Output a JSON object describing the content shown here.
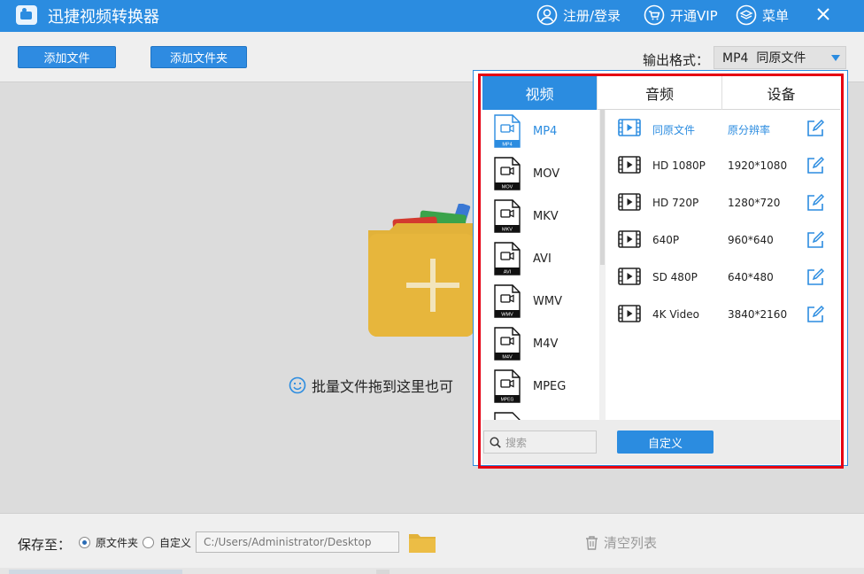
{
  "app": {
    "title": "迅捷视频转换器",
    "register_login": "注册/登录",
    "open_vip": "开通VIP",
    "menu": "菜单"
  },
  "toolbar": {
    "add_file": "添加文件",
    "add_folder": "添加文件夹",
    "output_format_label": "输出格式：",
    "output_format_value": "MP4  同原文件"
  },
  "drop_area": {
    "hint": "批量文件拖到这里也可"
  },
  "bottom": {
    "save_to_label": "保存至：",
    "option_original": "原文件夹",
    "option_custom": "自定义",
    "path": "C:/Users/Administrator/Desktop",
    "clear_list": "清空列表"
  },
  "popup": {
    "tabs": [
      {
        "label": "视频",
        "active": true
      },
      {
        "label": "音频",
        "active": false
      },
      {
        "label": "设备",
        "active": false
      }
    ],
    "formats": [
      {
        "label": "MP4",
        "tag": "MP4",
        "selected": true
      },
      {
        "label": "MOV",
        "tag": "MOV",
        "selected": false
      },
      {
        "label": "MKV",
        "tag": "MKV",
        "selected": false
      },
      {
        "label": "AVI",
        "tag": "AVI",
        "selected": false
      },
      {
        "label": "WMV",
        "tag": "WMV",
        "selected": false
      },
      {
        "label": "M4V",
        "tag": "M4V",
        "selected": false
      },
      {
        "label": "MPEG",
        "tag": "MPEG",
        "selected": false
      }
    ],
    "presets": [
      {
        "name": "同原文件",
        "resolution": "原分辨率",
        "highlight": true
      },
      {
        "name": "HD 1080P",
        "resolution": "1920*1080",
        "highlight": false
      },
      {
        "name": "HD 720P",
        "resolution": "1280*720",
        "highlight": false
      },
      {
        "name": "640P",
        "resolution": "960*640",
        "highlight": false
      },
      {
        "name": "SD 480P",
        "resolution": "640*480",
        "highlight": false
      },
      {
        "name": "4K Video",
        "resolution": "3840*2160",
        "highlight": false
      }
    ],
    "search_placeholder": "搜索",
    "custom_button": "自定义"
  },
  "colors": {
    "accent": "#2b8ce0",
    "highlight_border": "#e60012",
    "folder_yellow": "#e2b23a"
  }
}
